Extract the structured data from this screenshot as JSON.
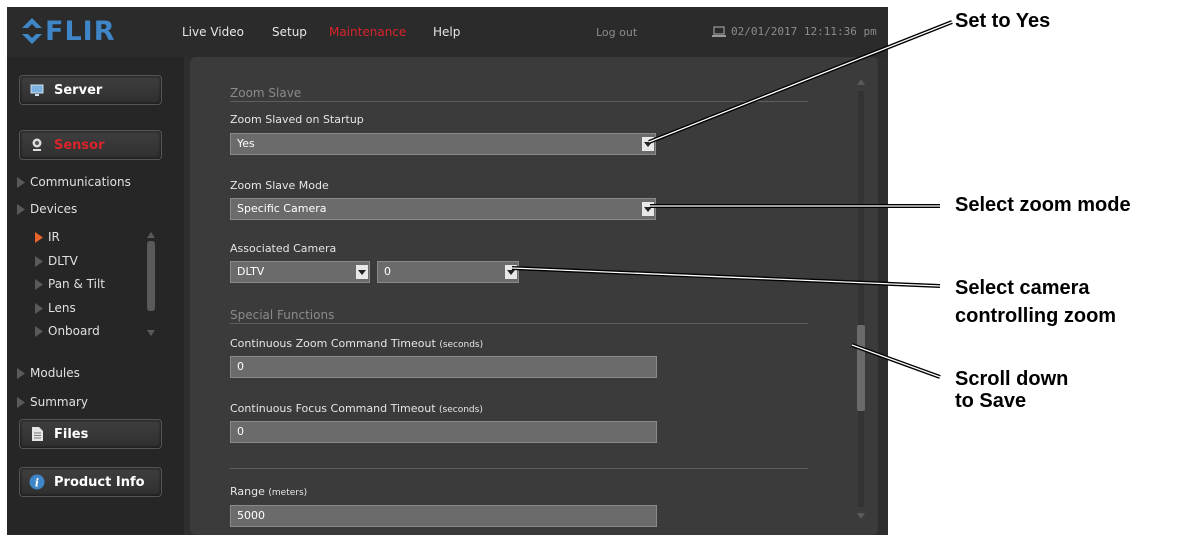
{
  "header": {
    "logo_text": "FLIR",
    "nav": [
      "Live Video",
      "Setup",
      "Maintenance",
      "Help"
    ],
    "active_nav": "Maintenance",
    "logout": "Log out",
    "datetime": "02/01/2017 12:11:36 pm"
  },
  "sidebar": {
    "buttons": {
      "server": "Server",
      "sensor": "Sensor",
      "files": "Files",
      "product_info": "Product Info"
    },
    "items": {
      "communications": "Communications",
      "devices": "Devices",
      "ir": "IR",
      "dltv": "DLTV",
      "pan_tilt": "Pan & Tilt",
      "lens": "Lens",
      "onboard": "Onboard",
      "modules": "Modules",
      "summary": "Summary"
    }
  },
  "main": {
    "zoom_slave": {
      "title": "Zoom Slave",
      "startup_label": "Zoom Slaved on Startup",
      "startup_value": "Yes",
      "mode_label": "Zoom Slave Mode",
      "mode_value": "Specific Camera",
      "assoc_label": "Associated Camera",
      "assoc_camera": "DLTV",
      "assoc_index": "0"
    },
    "special_functions": {
      "title": "Special Functions",
      "cont_zoom_label": "Continuous Zoom Command Timeout",
      "cont_zoom_unit": "(seconds)",
      "cont_zoom_value": "0",
      "cont_focus_label": "Continuous Focus Command Timeout",
      "cont_focus_unit": "(seconds)",
      "cont_focus_value": "0",
      "range_label": "Range",
      "range_unit": "(meters)",
      "range_value": "5000"
    }
  },
  "callouts": {
    "set_yes": "Set to Yes",
    "select_mode": "Select zoom mode",
    "select_camera_1": "Select camera",
    "select_camera_2": "controlling zoom",
    "scroll_1": "Scroll down",
    "scroll_2": "to Save"
  },
  "colors": {
    "brand_blue": "#3f86c9",
    "active_red": "#d8242b",
    "ir_orange": "#e8642a"
  }
}
